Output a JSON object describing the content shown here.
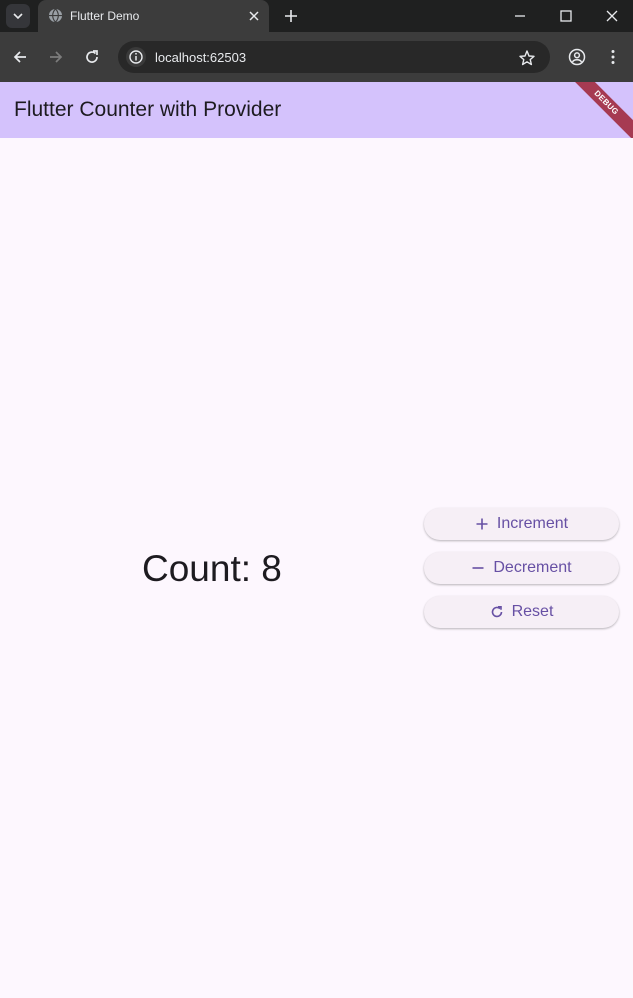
{
  "browser": {
    "tab_title": "Flutter Demo",
    "url": "localhost:62503"
  },
  "app": {
    "title": "Flutter Counter with Provider",
    "debug_label": "DEBUG",
    "count_text": "Count: 8",
    "buttons": {
      "increment": "Increment",
      "decrement": "Decrement",
      "reset": "Reset"
    }
  },
  "colors": {
    "appbar": "#d4c2fc",
    "background": "#fdf7fe",
    "button_text": "#6750a4",
    "debug_banner": "#a63a52"
  },
  "icons": [
    "tab-search-icon",
    "globe-icon",
    "close-icon",
    "plus-icon",
    "minimize-icon",
    "maximize-icon",
    "back-arrow-icon",
    "forward-arrow-icon",
    "reload-icon",
    "info-icon",
    "star-icon",
    "profile-icon",
    "more-vert-icon",
    "add-icon",
    "remove-icon",
    "refresh-icon"
  ]
}
